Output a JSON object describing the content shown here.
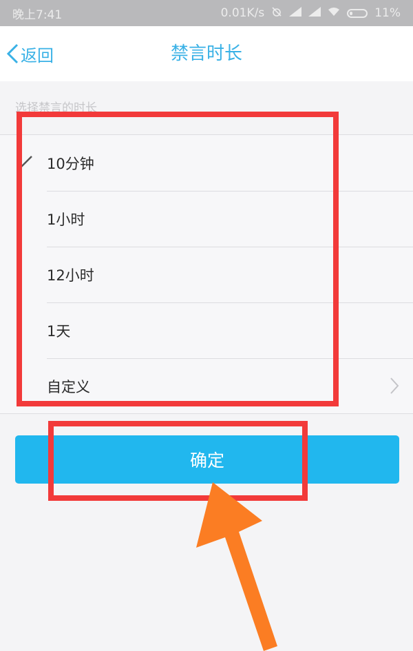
{
  "status_bar": {
    "time": "晚上7:41",
    "net_speed": "0.01K/s",
    "battery": "11%",
    "icons": [
      "alarm-off-icon",
      "signal-icon",
      "signal-icon",
      "wifi-icon",
      "battery-icon"
    ]
  },
  "nav": {
    "back_label": "返回",
    "title": "禁言时长"
  },
  "section_label": "选择禁言的时长",
  "options": [
    {
      "label": "10分钟",
      "selected": true
    },
    {
      "label": "1小时",
      "selected": false
    },
    {
      "label": "12小时",
      "selected": false
    },
    {
      "label": "1天",
      "selected": false
    },
    {
      "label": "自定义",
      "selected": false,
      "has_chevron": true
    }
  ],
  "confirm_label": "确定",
  "colors": {
    "accent": "#39b1e6",
    "button": "#21b7ee",
    "highlight_box": "#f23a3a",
    "arrow": "#fb7d23"
  }
}
